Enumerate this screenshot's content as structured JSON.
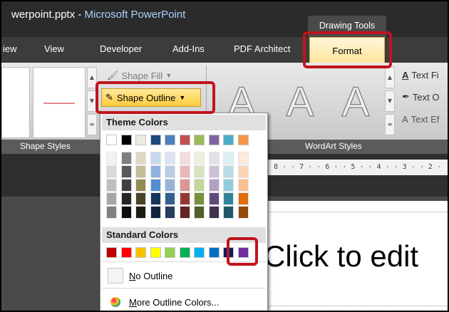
{
  "window": {
    "title_file": "werpoint.pptx - ",
    "title_app": "Microsoft PowerPoint",
    "context_tab": "Drawing Tools"
  },
  "tabs": [
    {
      "label": "iew"
    },
    {
      "label": "View"
    },
    {
      "label": "Developer"
    },
    {
      "label": "Add-Ins"
    },
    {
      "label": "PDF Architect"
    },
    {
      "label": "Format"
    }
  ],
  "ribbon": {
    "shape_fill_label": "Shape Fill",
    "shape_outline_label": "Shape Outline",
    "text_fill_label": "Text Fi",
    "text_outline_label": "Text O",
    "text_effects_label": "Text Ef",
    "shape_styles_label": "Shape Styles",
    "wordart_styles_label": "WordArt Styles",
    "wordart_letter": "A"
  },
  "ruler": {
    "text": "· 8 · · 7 · · 6 · · 5 · · 4 · · 3 · · 2 ·"
  },
  "slide": {
    "title_placeholder": "Click to edit"
  },
  "dropdown": {
    "theme_colors_header": "Theme Colors",
    "standard_colors_header": "Standard Colors",
    "no_outline_prefix": "N",
    "no_outline_rest": "o Outline",
    "more_colors_prefix": "M",
    "more_colors_rest": "ore Outline Colors...",
    "theme_top_row": [
      "#ffffff",
      "#000000",
      "#eeece1",
      "#1f497d",
      "#4f81bd",
      "#c0504d",
      "#9bbb59",
      "#8064a2",
      "#4bacc6",
      "#f79646"
    ],
    "theme_shade_columns": [
      [
        "#f2f2f2",
        "#d9d9d9",
        "#bfbfbf",
        "#a6a6a6",
        "#808080"
      ],
      [
        "#7f7f7f",
        "#595959",
        "#404040",
        "#262626",
        "#0d0d0d"
      ],
      [
        "#ddd9c3",
        "#c4bd97",
        "#948a54",
        "#4a452a",
        "#1e1c11"
      ],
      [
        "#c6d9f0",
        "#8db3e2",
        "#548dd4",
        "#17365d",
        "#0f243e"
      ],
      [
        "#dbe5f1",
        "#b8cce4",
        "#95b3d7",
        "#366092",
        "#244061"
      ],
      [
        "#f2dcdb",
        "#e6b9b8",
        "#d99694",
        "#953734",
        "#632423"
      ],
      [
        "#ebf1dd",
        "#d7e3bc",
        "#c3d69b",
        "#76923c",
        "#4f6128"
      ],
      [
        "#e5e0ec",
        "#ccc1d9",
        "#b2a1c7",
        "#5f497a",
        "#3f3151"
      ],
      [
        "#dbeef3",
        "#b7dde8",
        "#92cddc",
        "#31859b",
        "#205867"
      ],
      [
        "#fdeada",
        "#fbd5b5",
        "#fac08f",
        "#e36c09",
        "#974806"
      ]
    ],
    "standard_colors": [
      "#c00000",
      "#ff0000",
      "#ffc000",
      "#ffff00",
      "#92d050",
      "#00b050",
      "#00b0f0",
      "#0070c0",
      "#002060",
      "#7030a0"
    ]
  },
  "colors": {
    "highlight": "#c0141e",
    "format_tab": "#fde39a",
    "shape_outline_button": "#ffcb3d"
  }
}
